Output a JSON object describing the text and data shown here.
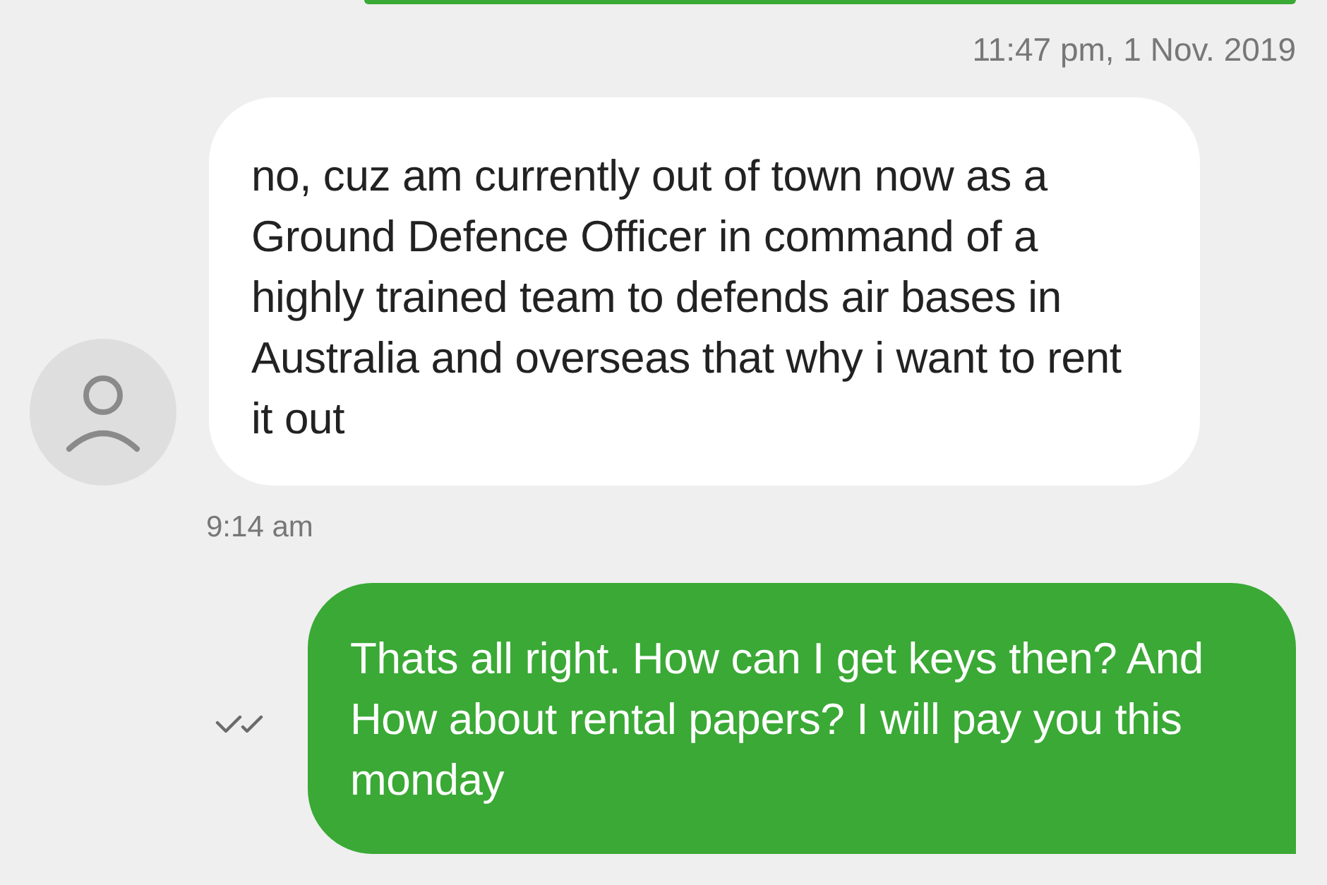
{
  "messages": [
    {
      "kind": "outgoing_partial",
      "time": "11:47 pm, 1 Nov. 2019"
    },
    {
      "kind": "incoming",
      "text": "no, cuz am currently out of town now as a Ground Defence Officer in command of a highly trained team to defends air bases in Australia and overseas that why i want to rent it out",
      "time": "9:14 am"
    },
    {
      "kind": "outgoing",
      "text": "Thats all right. How can I get keys then? And How about rental papers? I will pay you this monday",
      "read": true
    }
  ]
}
